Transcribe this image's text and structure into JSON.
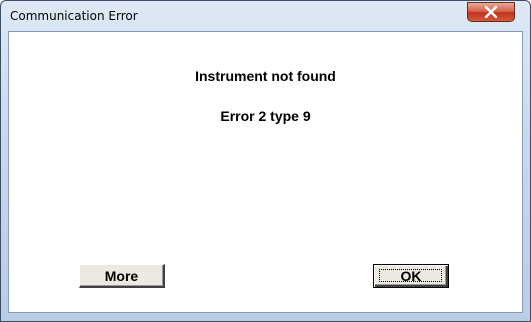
{
  "window": {
    "title": "Communication Error",
    "close_icon": "close-icon"
  },
  "message": {
    "line1": "Instrument not found",
    "line2": "Error 2 type 9"
  },
  "buttons": {
    "more_label": "More",
    "ok_label": "OK"
  },
  "colors": {
    "titlebar": "#c9d9ec",
    "close_button": "#c1341a",
    "button_face": "#ece9e2"
  }
}
